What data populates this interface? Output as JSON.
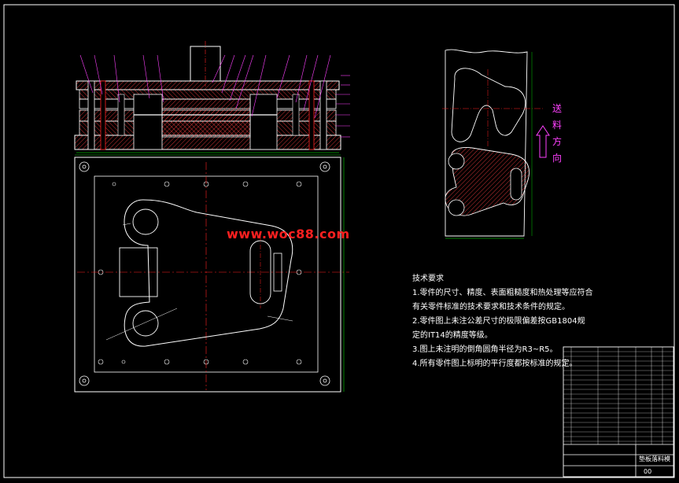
{
  "watermark": "www.woc88.com",
  "feed_direction": [
    "送",
    "料",
    "方",
    "向"
  ],
  "technical_requirements": {
    "title": "技术要求",
    "lines": [
      "1.零件的尺寸、精度、表面粗糙度和热处理等应符合",
      "有关零件标准的技术要求和技术条件的规定。",
      "2.零件图上未注公差尺寸的极限偏差按GB1804规",
      "定的IT14的精度等级。",
      "3.图上未注明的倒角圆角半径为R3~R5。",
      "4.所有零件图上标明的平行度都按标准的规定。"
    ]
  },
  "title_block": {
    "drawing_name": "垫板落料模",
    "sheet_label": "00"
  },
  "colors": {
    "background": "#000000",
    "outline": "#ffffff",
    "centerline": "#ff2020",
    "hatch": "#ff4040",
    "leader": "#ff40ff",
    "dimension": "#00ff00",
    "frame": "#ffffff"
  }
}
